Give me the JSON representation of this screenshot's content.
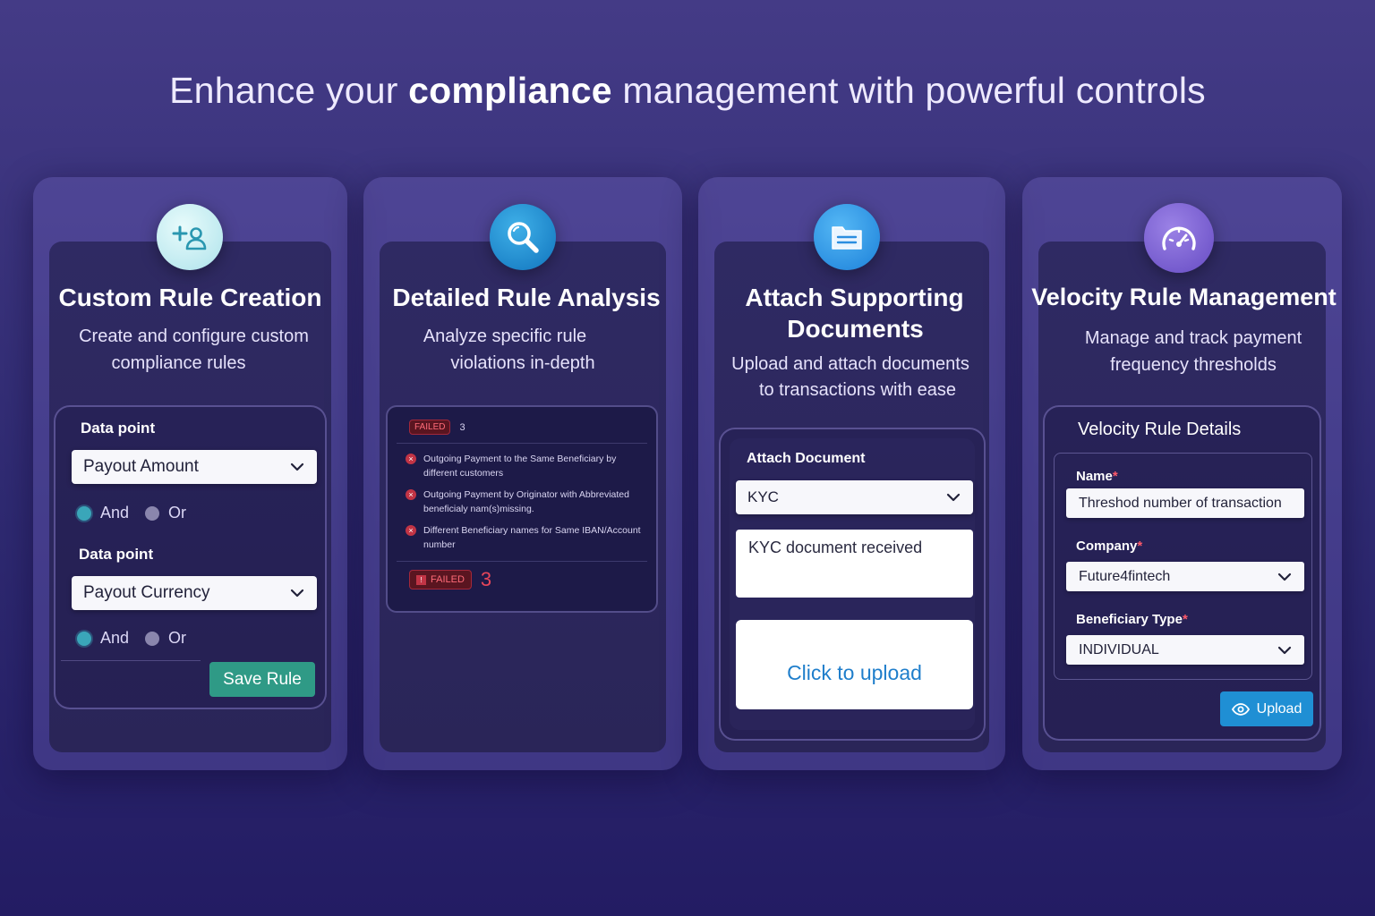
{
  "headline": {
    "prefix": "Enhance your ",
    "emphasis": "compliance",
    "suffix": " management with powerful controls"
  },
  "cards": [
    {
      "title": "Custom Rule Creation",
      "desc_line1": "Create and configure custom",
      "desc_line2": "compliance rules",
      "icon": "add-user-icon",
      "panel": {
        "label1": "Data point",
        "select1": "Payout Amount",
        "and1": "And",
        "or1": "Or",
        "label2": "Data point",
        "select2": "Payout Currency",
        "and2": "And",
        "or2": "Or",
        "save": "Save Rule"
      }
    },
    {
      "title": "Detailed Rule Analysis",
      "desc_line1": "Analyze specific rule",
      "desc_line2": "violations in-depth",
      "icon": "search-icon",
      "panel": {
        "badge": "FAILED",
        "count": "3",
        "violations": [
          {
            "line1": "Outgoing Payment to the Same Beneficiary by",
            "line2": "different customers"
          },
          {
            "line1": "Outgoing Payment by Originator with Abbreviated",
            "line2": "beneficialy nam(s)missing."
          },
          {
            "line1": "Different Beneficiary names for Same IBAN/Account",
            "line2": "number"
          }
        ],
        "footer_badge": "FAILED",
        "footer_count": "3"
      }
    },
    {
      "title_line1": "Attach Supporting",
      "title_line2": "Documents",
      "desc_line1": "Upload and attach documents",
      "desc_line2": "to transactions with ease",
      "icon": "document-icon",
      "panel": {
        "label": "Attach Document",
        "select": "KYC",
        "note": "KYC document received",
        "upload": "Click to upload"
      }
    },
    {
      "title": "Velocity Rule Management",
      "desc_line1": "Manage and track payment",
      "desc_line2": "frequency thresholds",
      "icon": "speedometer-icon",
      "panel": {
        "heading": "Velocity Rule Details",
        "name_label": "Name",
        "name_value": "Threshod number of transaction",
        "company_label": "Company",
        "company_value": "Future4fintech",
        "beneficiary_label": "Beneficiary Type",
        "beneficiary_value": "INDIVIDUAL",
        "required_mark": "*",
        "upload": "Upload"
      }
    }
  ],
  "colors": {
    "accent_teal": "#2f9a86",
    "accent_blue": "#1f8fd4",
    "failed_red": "#c23445"
  }
}
